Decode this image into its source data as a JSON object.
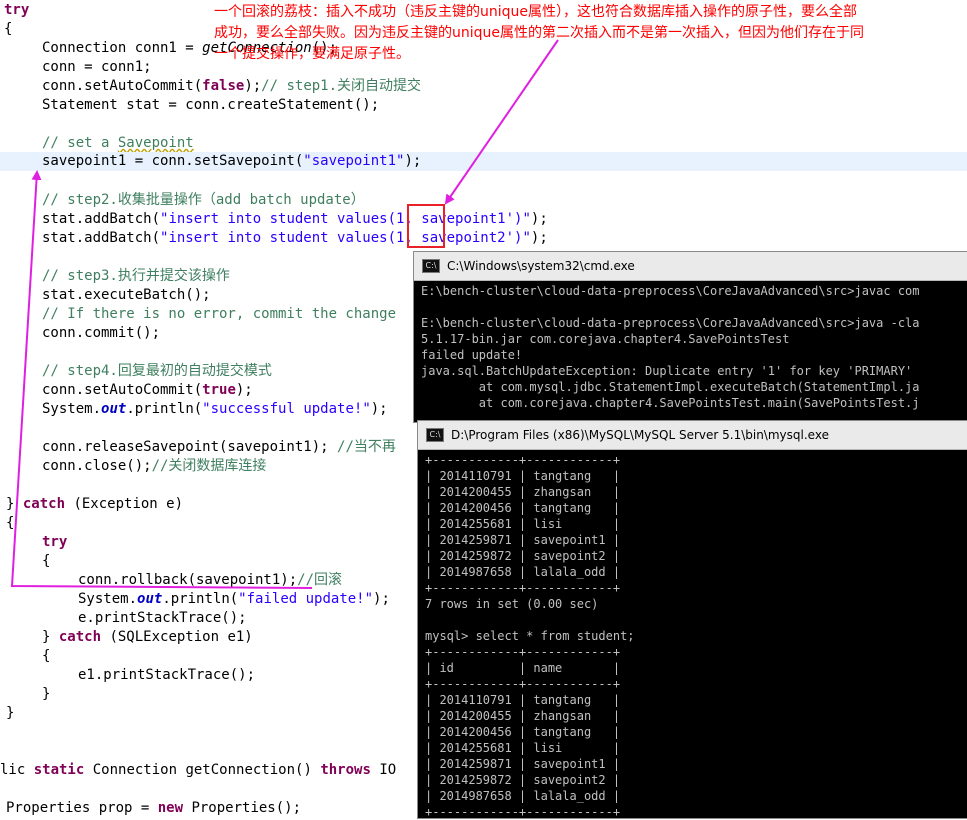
{
  "annotation": {
    "lines": [
      "一个回滚的荔枝：插入不成功（违反主键的unique属性），这也符合数据库插入操作的原子性，要么全部",
      "成功，要么全部失败。因为违反主键的unique属性的第二次插入而不是第一次插入，但因为他们存在于同",
      "一个提交操作，要满足原子性。"
    ]
  },
  "code": {
    "l_try": "try",
    "l_brace_open": "{",
    "l_conn_type": "Connection conn1 = ",
    "l_conn_call": "getConnection",
    "l_conn_end": "();",
    "l_conn_assign": "conn = conn1;",
    "l_autocommit_pre": "conn.setAutoCommit(",
    "l_false": "false",
    "l_autocommit_post": ");",
    "l_cm_step1": "// step1.关闭自动提交",
    "l_stmt": "Statement stat = conn.createStatement();",
    "l_cm_sp_a": "// set a ",
    "l_cm_sp_b": "Savepoint",
    "l_sp_pre": "savepoint1 = conn.setSavepoint(",
    "l_sp_str": "\"savepoint1\"",
    "l_sp_post": ");",
    "l_cm_step2": "// step2.收集批量操作（add batch update）",
    "l_batch_pre": "stat.addBatch(",
    "l_batch1_str": "\"insert into student values(1, savepoint1')\"",
    "l_batch2_str": "\"insert into student values(1, savepoint2')\"",
    "l_batch_post": ");",
    "l_cm_step3": "// step3.执行并提交该操作",
    "l_exec": "stat.executeBatch();",
    "l_cm_noerr": "// If there is no error, commit the change",
    "l_commit": "conn.commit();",
    "l_cm_step4": "// step4.回复最初的自动提交模式",
    "l_true": "true",
    "l_println_pre": "System.",
    "l_out": "out",
    "l_println_mid": ".println(",
    "l_success_str": "\"successful update!\"",
    "l_release": "conn.releaseSavepoint(savepoint1); ",
    "l_cm_release": "//当不再",
    "l_close": "conn.close();",
    "l_cm_close": "//关闭数据库连接",
    "l_catch_open": "} ",
    "l_catch_kw": "catch",
    "l_catch_ex": " (Exception e)",
    "l_rollback": "conn.rollback(savepoint1);",
    "l_cm_rollback": "//回滚",
    "l_failed_str": "\"failed update!\"",
    "l_trace": "e.printStackTrace();",
    "l_sqlex": " (SQLException e1)",
    "l_trace1": "e1.printStackTrace();",
    "l_brace_close": "}",
    "l_static_pre": "lic ",
    "l_static_kw": "static",
    "l_static_mid": " Connection getConnection() ",
    "l_throws": "throws",
    "l_static_post": " IO",
    "l_props_pre": "Properties prop = ",
    "l_new": "new",
    "l_props_post": " Properties();"
  },
  "cmd_window": {
    "title": "C:\\Windows\\system32\\cmd.exe",
    "lines": [
      "E:\\bench-cluster\\cloud-data-preprocess\\CoreJavaAdvanced\\src>javac com",
      "",
      "E:\\bench-cluster\\cloud-data-preprocess\\CoreJavaAdvanced\\src>java -cla",
      "5.1.17-bin.jar com.corejava.chapter4.SavePointsTest",
      "failed update!",
      "java.sql.BatchUpdateException: Duplicate entry '1' for key 'PRIMARY'",
      "        at com.mysql.jdbc.StatementImpl.executeBatch(StatementImpl.ja",
      "        at com.corejava.chapter4.SavePointsTest.main(SavePointsTest.j"
    ]
  },
  "mysql_window": {
    "title": "D:\\Program Files (x86)\\MySQL\\MySQL Server 5.1\\bin\\mysql.exe",
    "lines": [
      "+------------+------------+",
      "| 2014110791 | tangtang   |",
      "| 2014200455 | zhangsan   |",
      "| 2014200456 | tangtang   |",
      "| 2014255681 | lisi       |",
      "| 2014259871 | savepoint1 |",
      "| 2014259872 | savepoint2 |",
      "| 2014987658 | lalala_odd |",
      "+------------+------------+",
      "7 rows in set (0.00 sec)",
      "",
      "mysql> select * from student;",
      "+------------+------------+",
      "| id         | name       |",
      "+------------+------------+",
      "| 2014110791 | tangtang   |",
      "| 2014200455 | zhangsan   |",
      "| 2014200456 | tangtang   |",
      "| 2014255681 | lisi       |",
      "| 2014259871 | savepoint1 |",
      "| 2014259872 | savepoint2 |",
      "| 2014987658 | lalala_odd |",
      "+------------+------------+"
    ]
  },
  "colors": {
    "keyword": "#7f0055",
    "string": "#2a00ff",
    "comment": "#3f7f5f",
    "field": "#0000c0",
    "annotation": "#ff0000",
    "arrow": "#e020e0",
    "highlight": "#e8f2fe"
  }
}
